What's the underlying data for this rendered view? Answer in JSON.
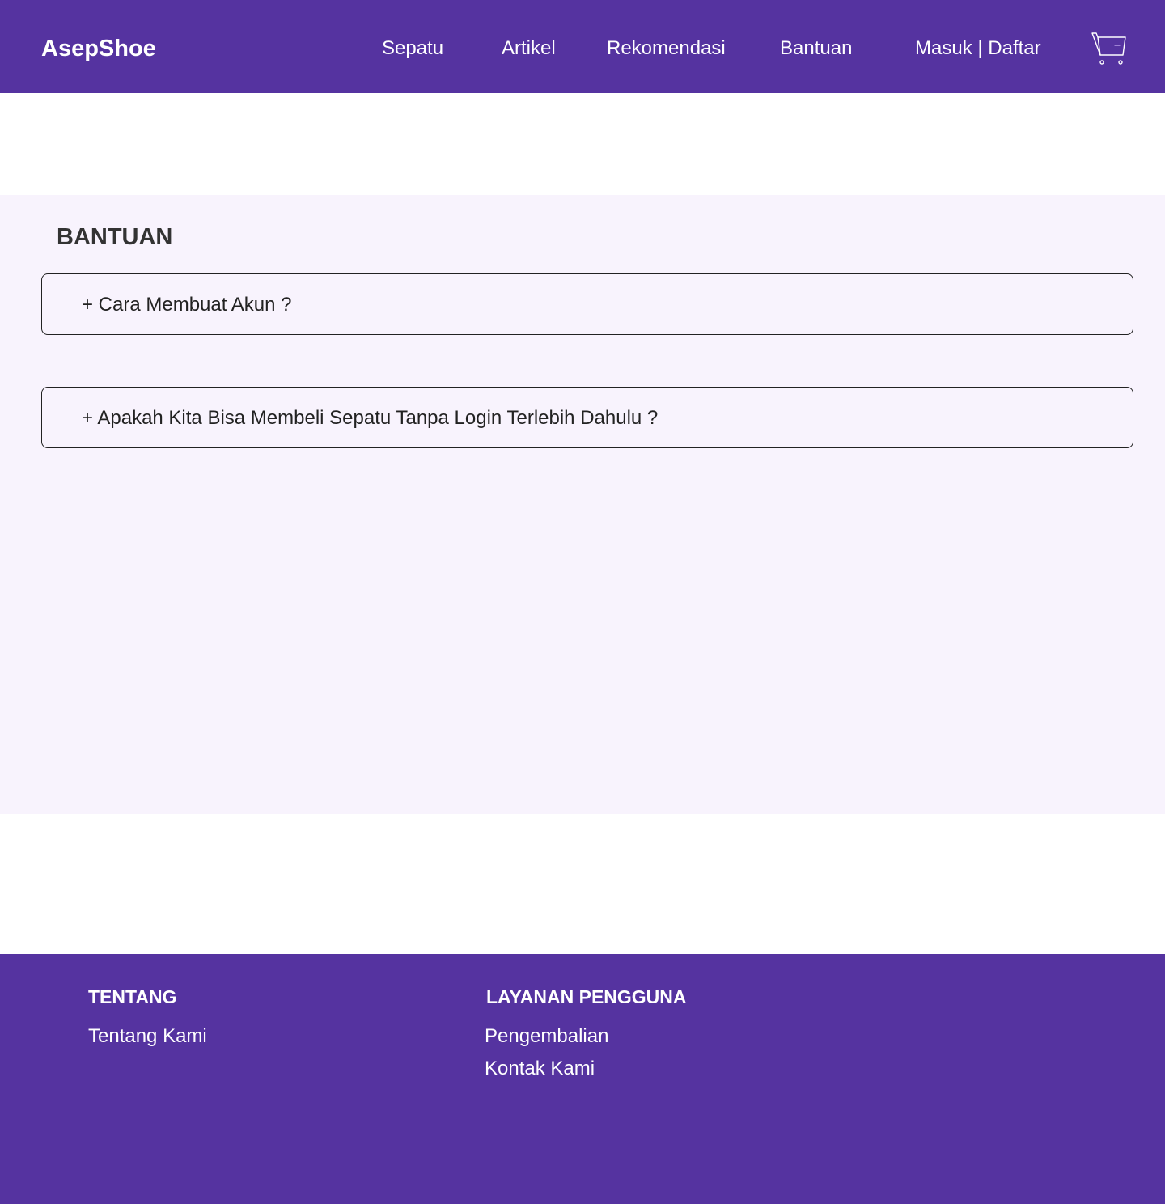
{
  "header": {
    "brand": "AsepShoe",
    "nav": {
      "sepatu": "Sepatu",
      "artikel": "Artikel",
      "rekomendasi": "Rekomendasi",
      "bantuan": "Bantuan",
      "auth": "Masuk | Daftar"
    },
    "cart_icon": "shopping-cart-icon"
  },
  "help": {
    "title": "BANTUAN",
    "faq": [
      {
        "question": "+ Cara Membuat Akun ?"
      },
      {
        "question": "+ Apakah Kita Bisa Membeli Sepatu Tanpa Login Terlebih Dahulu ?"
      }
    ]
  },
  "footer": {
    "about": {
      "heading": "TENTANG",
      "links": [
        "Tentang Kami"
      ]
    },
    "service": {
      "heading": "LAYANAN PENGGUNA",
      "links": [
        "Pengembalian",
        "Kontak Kami"
      ]
    }
  },
  "colors": {
    "brand_purple": "#5533a0",
    "section_bg": "#f8f3fd",
    "white": "#ffffff"
  }
}
